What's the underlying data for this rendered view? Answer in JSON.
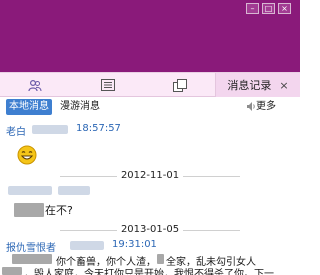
{
  "tabs": {
    "history_label": "消息记录",
    "close_glyph": "×"
  },
  "subtabs": {
    "local": "本地消息",
    "roaming": "漫游消息",
    "more": "更多"
  },
  "messages": {
    "m1_sender": "老白",
    "m1_time": "18:57:57",
    "date1": "2012-11-01",
    "m2_text": "在不?",
    "date2": "2013-01-05",
    "m3_sender": "报仇雪恨者",
    "m3_time": "19:31:01",
    "m3_line1_a": "你个畜兽，你个人渣，",
    "m3_line1_b": "全家，乱未勾引女人",
    "m3_line2": "，毁人家庭，今天打你只是开始，我恨不得杀了你。下一"
  },
  "colors": {
    "header": "#8a1a7a",
    "accent": "#3e7fd0",
    "sender": "#2c67b5"
  },
  "icons": [
    "contact-icon",
    "list-icon",
    "multi-window-icon",
    "speaker-icon",
    "smile-emoticon-icon",
    "minimize-icon",
    "maximize-icon",
    "close-icon"
  ]
}
